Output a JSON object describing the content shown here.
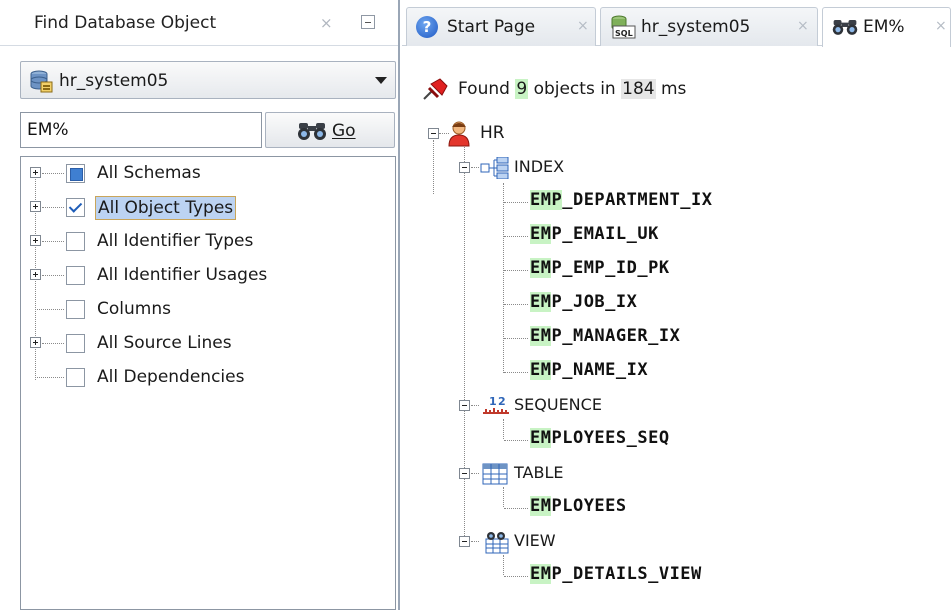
{
  "find_panel": {
    "title": "Find Database Object",
    "close_glyph": "×",
    "connection": "hr_system05",
    "search_value": "EM%",
    "go_label": "Go",
    "filters": [
      {
        "label": "All Schemas",
        "state": "partial"
      },
      {
        "label": "All Object Types",
        "state": "checked"
      },
      {
        "label": "All Identifier Types",
        "state": "unchecked"
      },
      {
        "label": "All Identifier Usages",
        "state": "unchecked"
      },
      {
        "label": "Columns",
        "state": "unchecked"
      },
      {
        "label": "All Source Lines",
        "state": "unchecked"
      },
      {
        "label": "All Dependencies",
        "state": "unchecked"
      }
    ]
  },
  "tabs": [
    {
      "label": "Start Page",
      "icon": "help-icon",
      "close": "×"
    },
    {
      "label": "hr_system05",
      "icon": "sql-worksheet-icon",
      "close": "×"
    },
    {
      "label": "EM%",
      "icon": "binoculars-icon",
      "close": "×",
      "active": true
    }
  ],
  "results": {
    "found_prefix": "Found",
    "found_count": "9",
    "found_mid": "objects in",
    "found_ms": "184",
    "found_unit": "ms",
    "schema": "HR",
    "groups": [
      {
        "type": "INDEX",
        "items": [
          {
            "match": "EMP",
            "rest": "_DEPARTMENT_IX"
          },
          {
            "match": "EM",
            "rest": "P_EMAIL_UK"
          },
          {
            "match": "EM",
            "rest": "P_EMP_ID_PK"
          },
          {
            "match": "EM",
            "rest": "P_JOB_IX"
          },
          {
            "match": "EM",
            "rest": "P_MANAGER_IX"
          },
          {
            "match": "EM",
            "rest": "P_NAME_IX"
          }
        ]
      },
      {
        "type": "SEQUENCE",
        "items": [
          {
            "match": "EM",
            "rest": "PLOYEES_SEQ"
          }
        ]
      },
      {
        "type": "TABLE",
        "items": [
          {
            "match": "EM",
            "rest": "PLOYEES"
          }
        ]
      },
      {
        "type": "VIEW",
        "items": [
          {
            "match": "EM",
            "rest": "P_DETAILS_VIEW"
          }
        ]
      }
    ]
  },
  "colors": {
    "match_highlight": "#c8f3c4",
    "selection": "#bcd3f2",
    "panel_border": "#9aa6b6"
  }
}
